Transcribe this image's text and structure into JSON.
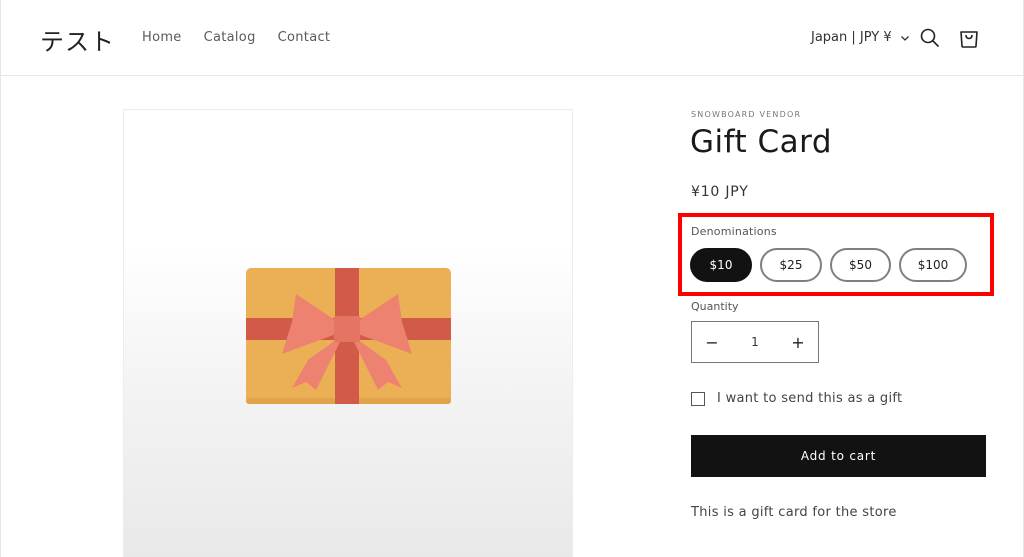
{
  "header": {
    "logo": "テスト",
    "nav": [
      {
        "label": "Home"
      },
      {
        "label": "Catalog"
      },
      {
        "label": "Contact"
      }
    ],
    "currency": "Japan | JPY ¥",
    "icons": {
      "search": "search-icon",
      "cart": "cart-icon",
      "chevron": "chevron-down-icon"
    }
  },
  "product": {
    "vendor": "SNOWBOARD VENDOR",
    "title": "Gift Card",
    "price": "¥10 JPY",
    "denominations_label": "Denominations",
    "denominations": [
      {
        "label": "$10",
        "selected": true
      },
      {
        "label": "$25",
        "selected": false
      },
      {
        "label": "$50",
        "selected": false
      },
      {
        "label": "$100",
        "selected": false
      }
    ],
    "quantity_label": "Quantity",
    "quantity": "1",
    "minus": "−",
    "plus": "+",
    "gift_checkbox_label": "I want to send this as a gift",
    "gift_checked": false,
    "add_to_cart": "Add to cart",
    "description": "This is a gift card for the store"
  },
  "colors": {
    "highlight": "#ff0000",
    "button": "#121212",
    "card": "#ebb055",
    "ribbon": "#d25a48",
    "bow": "#ee8270"
  }
}
